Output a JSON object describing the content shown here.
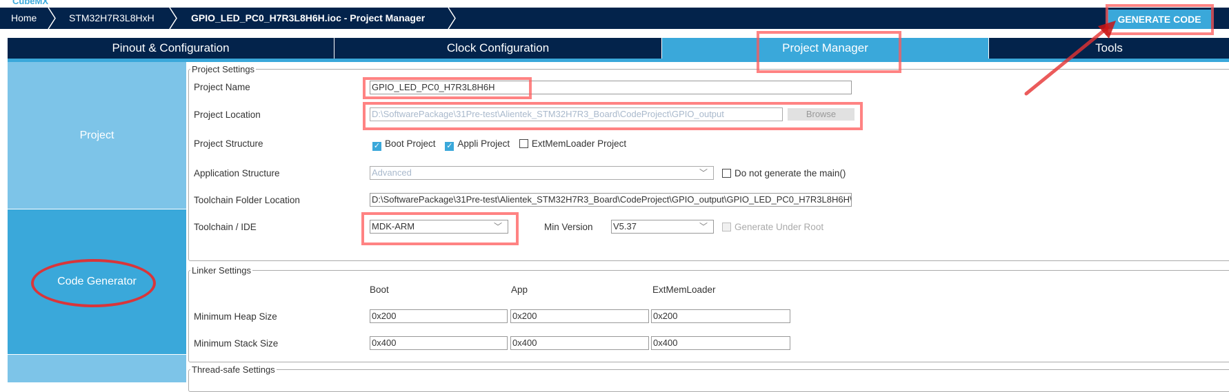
{
  "app": {
    "logo": "CubeMX"
  },
  "breadcrumb": [
    "Home",
    "STM32H7R3L8HxH",
    "GPIO_LED_PC0_H7R3L8H6H.ioc - Project Manager"
  ],
  "generate_button": "GENERATE CODE",
  "tabs": [
    {
      "label": "Pinout & Configuration"
    },
    {
      "label": "Clock Configuration"
    },
    {
      "label": "Project Manager",
      "active": true
    },
    {
      "label": "Tools"
    }
  ],
  "sidebar": [
    {
      "label": "Project"
    },
    {
      "label": "Code Generator",
      "active": true
    }
  ],
  "project_settings": {
    "legend": "Project Settings",
    "project_name_label": "Project Name",
    "project_name": "GPIO_LED_PC0_H7R3L8H6H",
    "project_location_label": "Project Location",
    "project_location": "D:\\SoftwarePackage\\31Pre-test\\Alientek_STM32H7R3_Board\\CodeProject\\GPIO_output",
    "browse": "Browse",
    "structure_label": "Project Structure",
    "structure_options": [
      {
        "label": "Boot Project",
        "checked": true
      },
      {
        "label": "Appli Project",
        "checked": true
      },
      {
        "label": "ExtMemLoader Project",
        "checked": false
      }
    ],
    "app_structure_label": "Application Structure",
    "app_structure": "Advanced",
    "no_main": "Do not generate the main()",
    "toolchain_folder_label": "Toolchain Folder Location",
    "toolchain_folder": "D:\\SoftwarePackage\\31Pre-test\\Alientek_STM32H7R3_Board\\CodeProject\\GPIO_output\\GPIO_LED_PC0_H7R3L8H6H\\",
    "toolchain_label": "Toolchain / IDE",
    "toolchain": "MDK-ARM",
    "min_version_label": "Min Version",
    "min_version": "V5.37",
    "gen_under_root": "Generate Under Root"
  },
  "linker": {
    "legend": "Linker Settings",
    "columns": [
      "Boot",
      "App",
      "ExtMemLoader"
    ],
    "heap_label": "Minimum Heap Size",
    "heap": [
      "0x200",
      "0x200",
      "0x200"
    ],
    "stack_label": "Minimum Stack Size",
    "stack": [
      "0x400",
      "0x400",
      "0x400"
    ]
  },
  "thread_safe": {
    "legend": "Thread-safe Settings"
  },
  "annotation_color": "#ff5a5a"
}
